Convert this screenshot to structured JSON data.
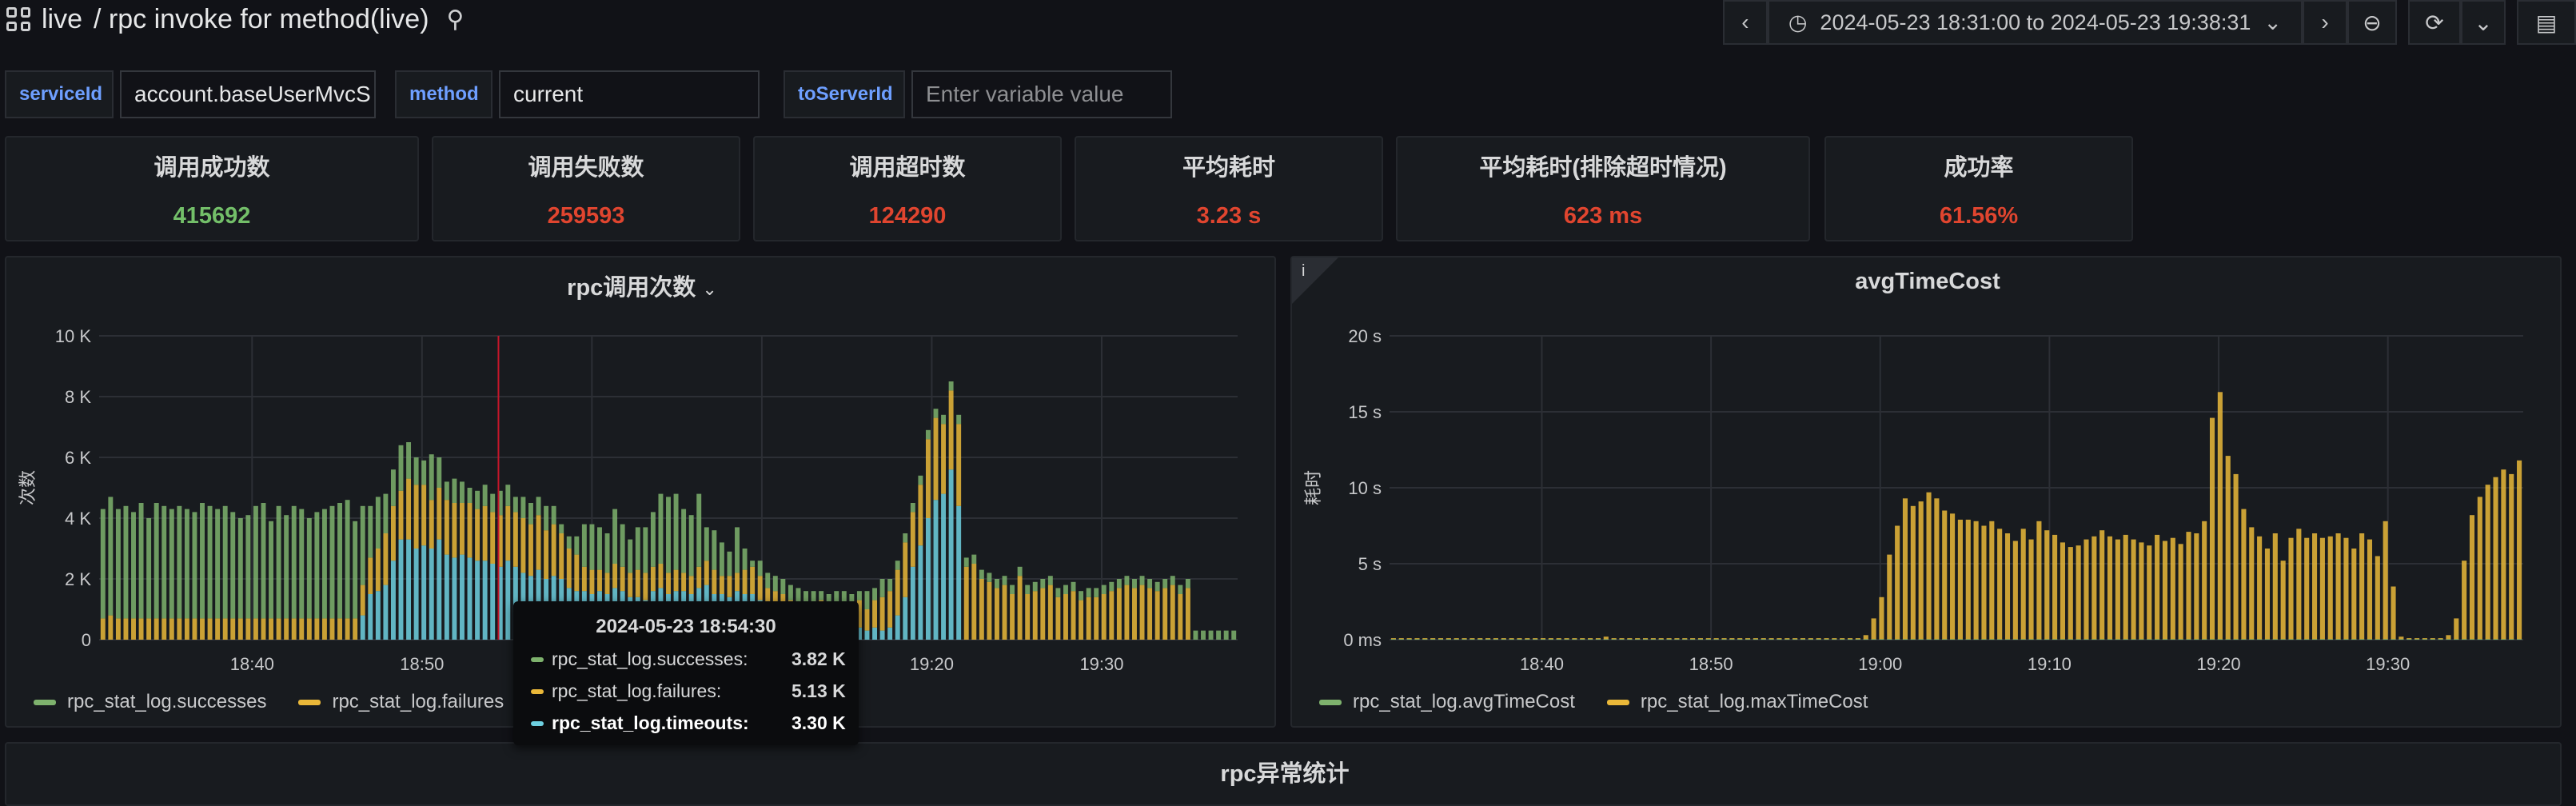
{
  "header": {
    "folder": "live",
    "title": "/ rpc invoke for method(live)",
    "time_range": "2024-05-23 18:31:00 to 2024-05-23 19:38:31"
  },
  "variables": [
    {
      "label": "serviceId",
      "value": "account.baseUserMvcS",
      "placeholder": ""
    },
    {
      "label": "method",
      "value": "current",
      "placeholder": ""
    },
    {
      "label": "toServerId",
      "value": "",
      "placeholder": "Enter variable value"
    }
  ],
  "stats": [
    {
      "title": "调用成功数",
      "value": "415692",
      "color": "#73bf69"
    },
    {
      "title": "调用失败数",
      "value": "259593",
      "color": "#e0452f"
    },
    {
      "title": "调用超时数",
      "value": "124290",
      "color": "#e0452f"
    },
    {
      "title": "平均耗时",
      "value": "3.23 s",
      "color": "#e0452f"
    },
    {
      "title": "平均耗时(排除超时情况)",
      "value": "623 ms",
      "color": "#e0452f"
    },
    {
      "title": "成功率",
      "value": "61.56%",
      "color": "#e0452f"
    }
  ],
  "colors": {
    "green": "#7eb26d",
    "yellow": "#eab839",
    "blue": "#6ed0e0",
    "accent_red": "#e0452f"
  },
  "chart_data": [
    {
      "type": "bar",
      "title": "rpc调用次数",
      "ylabel": "次数",
      "ylim": [
        0,
        10000
      ],
      "yticks": [
        "0",
        "2 K",
        "4 K",
        "6 K",
        "8 K",
        "10 K"
      ],
      "xticks": [
        "18:40",
        "18:50",
        "19:00",
        "19:10",
        "19:20",
        "19:30"
      ],
      "x_start": "18:31",
      "x_end": "19:38",
      "stacked": true,
      "grid": true,
      "legend": "bottom-left",
      "series": [
        {
          "name": "rpc_stat_log.successes",
          "color": "#7eb26d",
          "values": [
            3600,
            3900,
            3600,
            3700,
            3500,
            3800,
            3300,
            3800,
            3700,
            3600,
            3700,
            3600,
            3500,
            3800,
            3700,
            3600,
            3700,
            3500,
            3300,
            3400,
            3700,
            3800,
            3200,
            3700,
            3400,
            3700,
            3600,
            3300,
            3500,
            3600,
            3700,
            3800,
            3900,
            3200,
            2600,
            1700,
            1700,
            1300,
            1200,
            1500,
            1200,
            900,
            800,
            1500,
            1000,
            600,
            800,
            700,
            500,
            600,
            700,
            600,
            800,
            700,
            500,
            700,
            700,
            600,
            800,
            600,
            300,
            400,
            600,
            1400,
            1500,
            1400,
            1300,
            1800,
            1400,
            1100,
            1400,
            1500,
            1800,
            2300,
            2500,
            2500,
            2100,
            2000,
            2400,
            1100,
            1300,
            1100,
            800,
            1500,
            700,
            200,
            500,
            500,
            500,
            500,
            500,
            500,
            500,
            600,
            300,
            500,
            500,
            500,
            300,
            300,
            600,
            400,
            600,
            400,
            300,
            300,
            300,
            300,
            300,
            300,
            300,
            300,
            300,
            300,
            300,
            300,
            300,
            300,
            300,
            300,
            300,
            300,
            300,
            300,
            300,
            300,
            300,
            300,
            300,
            300,
            300,
            300,
            300,
            300,
            300,
            300,
            300,
            300,
            300,
            300,
            300,
            300,
            300,
            300,
            300,
            300,
            300,
            300,
            300
          ]
        },
        {
          "name": "rpc_stat_log.failures",
          "color": "#eab839",
          "values": [
            700,
            800,
            700,
            700,
            700,
            700,
            700,
            700,
            700,
            700,
            700,
            700,
            700,
            700,
            700,
            700,
            700,
            700,
            700,
            700,
            700,
            700,
            700,
            700,
            700,
            700,
            700,
            700,
            700,
            700,
            700,
            700,
            700,
            700,
            1000,
            1200,
            1400,
            1700,
            1800,
            1600,
            2000,
            2100,
            2000,
            1600,
            1700,
            1800,
            1800,
            1700,
            1800,
            1700,
            1800,
            1700,
            1700,
            1800,
            1800,
            1800,
            1700,
            1800,
            1600,
            1700,
            1500,
            1300,
            1200,
            800,
            800,
            700,
            700,
            800,
            800,
            800,
            900,
            900,
            800,
            800,
            700,
            700,
            600,
            600,
            700,
            800,
            800,
            600,
            700,
            600,
            800,
            900,
            800,
            700,
            700,
            700,
            700,
            700,
            700,
            700,
            900,
            700,
            700,
            700,
            900,
            900,
            700,
            900,
            1100,
            1200,
            1500,
            1800,
            1800,
            2000,
            2600,
            2700,
            2300,
            2600,
            2700,
            2400,
            2500,
            2000,
            1900,
            1700,
            1800,
            1500,
            2100,
            1500,
            1600,
            1700,
            1800,
            1400,
            1500,
            1600,
            1300,
            1400,
            1400,
            1500,
            1600,
            1700,
            1800,
            1700,
            1800,
            1700,
            1600,
            1700,
            1800,
            1500,
            1700
          ]
        },
        {
          "name": "rpc_stat_log.timeouts",
          "color": "#6ed0e0",
          "values": [
            0,
            0,
            0,
            0,
            0,
            0,
            0,
            0,
            0,
            0,
            0,
            0,
            0,
            0,
            0,
            0,
            0,
            0,
            0,
            0,
            0,
            0,
            0,
            0,
            0,
            0,
            0,
            0,
            0,
            0,
            0,
            0,
            0,
            0,
            800,
            1500,
            1600,
            1800,
            2600,
            3300,
            3300,
            3000,
            3100,
            3000,
            3300,
            2800,
            2700,
            2800,
            2700,
            2600,
            2600,
            2500,
            2400,
            2600,
            2400,
            2200,
            2100,
            2300,
            2000,
            2100,
            2000,
            1700,
            1600,
            1600,
            1500,
            1600,
            1500,
            1700,
            1600,
            1400,
            1400,
            1300,
            1600,
            1700,
            1500,
            1600,
            1600,
            1500,
            1700,
            1800,
            1500,
            1500,
            1400,
            1600,
            1500,
            1500,
            1300,
            1000,
            900,
            800,
            600,
            500,
            400,
            300,
            400,
            300,
            400,
            400,
            300,
            400,
            300,
            400,
            300,
            400,
            800,
            1400,
            2400,
            3100,
            4000,
            4600,
            4800,
            5600,
            4400,
            0,
            0,
            0,
            0,
            0,
            0,
            0,
            0,
            0,
            0,
            0,
            0,
            0,
            0,
            0,
            0,
            0,
            0,
            0,
            0,
            0,
            0,
            0,
            0,
            0,
            0,
            0,
            0,
            0,
            0,
            0,
            0,
            0
          ]
        }
      ]
    },
    {
      "type": "bar",
      "title": "avgTimeCost",
      "ylabel": "耗时",
      "ylim": [
        0,
        20
      ],
      "yticks": [
        "0 ms",
        "5 s",
        "10 s",
        "15 s",
        "20 s"
      ],
      "xticks": [
        "18:40",
        "18:50",
        "19:00",
        "19:10",
        "19:20",
        "19:30"
      ],
      "x_start": "18:31",
      "x_end": "19:38",
      "grid": true,
      "legend": "bottom-left",
      "series": [
        {
          "name": "rpc_stat_log.avgTimeCost",
          "color": "#7eb26d",
          "values": [
            0.05,
            0.05,
            0.05,
            0.05,
            0.05,
            0.05,
            0.05,
            0.05,
            0.05,
            0.05,
            0.05,
            0.05,
            0.05,
            0.05,
            0.05,
            0.05,
            0.05,
            0.05,
            0.05,
            0.05,
            0.05,
            0.05,
            0.05,
            0.05,
            0.05,
            0.05,
            0.05,
            0.05,
            0.05,
            0.05,
            0.05,
            0.05,
            0.05,
            0.05,
            0.05,
            0.05,
            0.05,
            0.05,
            0.05,
            0.05,
            0.05,
            0.05,
            0.05,
            0.05,
            0.05,
            0.05,
            0.05,
            0.05,
            0.05,
            0.05,
            0.05,
            0.05,
            0.05,
            0.05,
            0.05,
            0.05,
            0.05,
            0.05,
            0.05,
            0.05,
            0.05,
            0.05,
            0.05,
            0.05,
            0.05,
            0.05,
            0.05,
            0.05,
            0.05,
            0.05,
            0.05,
            0.05,
            0.05,
            0.05,
            0.05,
            0.05,
            0.05,
            0.05,
            0.05,
            0.05,
            0.05,
            0.05,
            0.05,
            0.05,
            0.05,
            0.05,
            0.05,
            0.05,
            0.05,
            0.05,
            0.05,
            0.05,
            0.05,
            0.05,
            0.05,
            0.05,
            0.05,
            0.05,
            0.05,
            0.05,
            0.05,
            0.05,
            0.05,
            0.05,
            0.05,
            0.05,
            0.05,
            0.05,
            0.05,
            0.05,
            0.05,
            0.05,
            0.05,
            0.05,
            0.05,
            0.05,
            0.05,
            0.05,
            0.05,
            0.05,
            0.05,
            0.05,
            0.05,
            0.05,
            0.05,
            0.05,
            0.05,
            0.05,
            0.05,
            0.05,
            0.05,
            0.05,
            0.05,
            0.05,
            0.05,
            0.05,
            0.05,
            0.05,
            0.05,
            0.05,
            0.05,
            0.05,
            0.05,
            0.05
          ]
        },
        {
          "name": "rpc_stat_log.maxTimeCost",
          "color": "#eab839",
          "values": [
            0.1,
            0.1,
            0.1,
            0.1,
            0.1,
            0.1,
            0.1,
            0.1,
            0.1,
            0.1,
            0.1,
            0.1,
            0.1,
            0.1,
            0.1,
            0.1,
            0.1,
            0.1,
            0.1,
            0.1,
            0.1,
            0.1,
            0.1,
            0.1,
            0.1,
            0.1,
            0.1,
            0.2,
            0.1,
            0.1,
            0.1,
            0.1,
            0.1,
            0.1,
            0.1,
            0.1,
            0.1,
            0.1,
            0.1,
            0.1,
            0.1,
            0.1,
            0.1,
            0.1,
            0.1,
            0.1,
            0.1,
            0.1,
            0.1,
            0.1,
            0.1,
            0.1,
            0.1,
            0.1,
            0.1,
            0.1,
            0.1,
            0.1,
            0.1,
            0.1,
            0.3,
            1.4,
            2.8,
            5.6,
            7.5,
            9.3,
            8.8,
            9.1,
            9.7,
            9.3,
            8.5,
            8.3,
            7.9,
            7.9,
            7.8,
            7.5,
            7.8,
            7.3,
            7.0,
            6.5,
            7.3,
            6.6,
            7.8,
            7.2,
            6.9,
            6.4,
            6.1,
            6.2,
            6.6,
            6.8,
            7.2,
            6.8,
            6.6,
            6.9,
            6.6,
            6.4,
            6.2,
            6.9,
            6.5,
            6.7,
            6.3,
            7.1,
            7.0,
            7.8,
            14.6,
            16.3,
            12.1,
            10.9,
            8.6,
            7.4,
            6.8,
            6.0,
            7.0,
            5.2,
            6.7,
            7.3,
            6.7,
            7.0,
            6.7,
            6.8,
            7.0,
            6.7,
            6.0,
            7.0,
            6.6,
            5.5,
            7.8,
            3.5,
            0.2,
            0.1,
            0.1,
            0.1,
            0.1,
            0.1,
            0.3,
            1.4,
            5.2,
            8.2,
            9.4,
            10.2,
            10.7,
            11.2,
            10.9,
            11.8,
            11.7,
            11.3,
            10.1,
            8.8,
            0.5,
            0.1,
            0.1,
            0.1,
            0.1,
            0.1,
            0.1,
            0.1,
            0.1,
            0.1,
            0.1,
            0.1,
            0.1,
            0.1,
            0.1,
            0.1,
            0.1,
            0.1,
            0.1,
            0.1,
            0.1,
            0.1,
            0.1,
            0.1,
            0.1,
            0.1,
            0.1,
            0.1,
            0.1,
            0.1,
            0.1,
            0.1,
            0.1,
            0.1
          ]
        }
      ]
    }
  ],
  "tooltip": {
    "time": "2024-05-23 18:54:30",
    "rows": [
      {
        "name": "rpc_stat_log.successes:",
        "value": "3.82 K",
        "color": "#7eb26d"
      },
      {
        "name": "rpc_stat_log.failures:",
        "value": "5.13 K",
        "color": "#eab839"
      },
      {
        "name": "rpc_stat_log.timeouts:",
        "value": "3.30 K",
        "color": "#6ed0e0"
      }
    ]
  },
  "bottom_panel": {
    "title": "rpc异常统计"
  }
}
